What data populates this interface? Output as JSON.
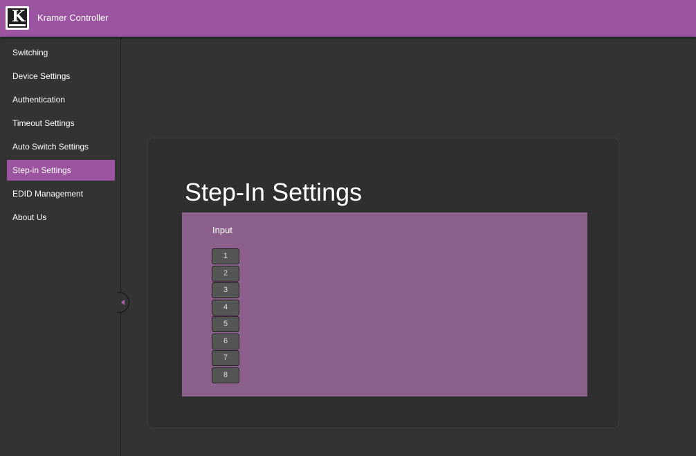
{
  "header": {
    "app_title": "Kramer Controller"
  },
  "sidebar": {
    "items": [
      {
        "label": "Switching"
      },
      {
        "label": "Device Settings"
      },
      {
        "label": "Authentication"
      },
      {
        "label": "Timeout Settings"
      },
      {
        "label": "Auto Switch Settings"
      },
      {
        "label": "Step-in Settings",
        "active": true
      },
      {
        "label": "EDID Management"
      },
      {
        "label": "About Us"
      }
    ]
  },
  "main": {
    "title": "Step-In Settings",
    "input_label": "Input",
    "inputs": [
      "1",
      "2",
      "3",
      "4",
      "5",
      "6",
      "7",
      "8"
    ]
  },
  "colors": {
    "accent": "#9b549f",
    "panel_accent": "#8b618c",
    "background": "#333333"
  },
  "icons": {
    "logo": "kramer-logo",
    "collapse": "collapse-left-icon"
  }
}
